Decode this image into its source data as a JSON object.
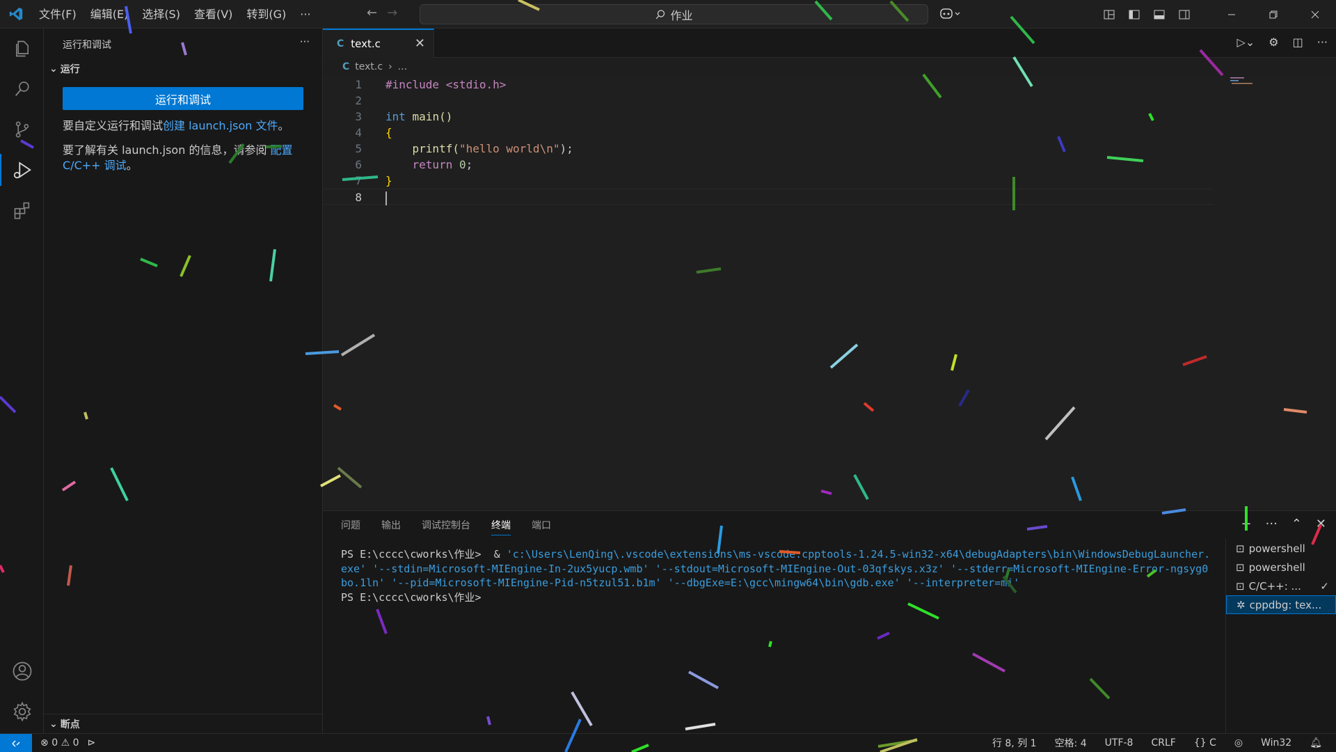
{
  "titlebar": {
    "menus": [
      "文件(F)",
      "编辑(E)",
      "选择(S)",
      "查看(V)",
      "转到(G)",
      "···"
    ],
    "search": "作业"
  },
  "sidebar": {
    "title": "运行和调试",
    "section": "运行",
    "run_button": "运行和调试",
    "text1_a": "要自定义运行和调试",
    "text1_link": "创建 launch.json 文件",
    "text1_b": "。",
    "text2_a": "要了解有关 launch.json 的信息，请参阅 ",
    "text2_link": "配置 C/C++ 调试",
    "text2_b": "。",
    "breakpoints": "断点"
  },
  "editor": {
    "tab_label": "text.c",
    "breadcrumb_file": "text.c",
    "breadcrumb_more": "...",
    "lines": [
      {
        "n": "1"
      },
      {
        "n": "2"
      },
      {
        "n": "3"
      },
      {
        "n": "4"
      },
      {
        "n": "5"
      },
      {
        "n": "6"
      },
      {
        "n": "7"
      },
      {
        "n": "8"
      }
    ],
    "code": {
      "l1": "#include <stdio.h>",
      "l3a": "int",
      "l3b": " main()",
      "l4": "{",
      "l5a": "    printf(",
      "l5b": "\"hello world\\n\"",
      "l5c": ");",
      "l6a": "    return ",
      "l6b": "0",
      "l6c": ";",
      "l7": "}"
    }
  },
  "panel": {
    "tabs": [
      "问题",
      "输出",
      "调试控制台",
      "终端",
      "端口"
    ],
    "active_tab": "终端",
    "terminal_prompt1": "PS E:\\cccc\\cworks\\作业>  & ",
    "terminal_cmd": "'c:\\Users\\LenQing\\.vscode\\extensions\\ms-vscode.cpptools-1.24.5-win32-x64\\debugAdapters\\bin\\WindowsDebugLauncher.exe' '--stdin=Microsoft-MIEngine-In-2ux5yucp.wmb' '--stdout=Microsoft-MIEngine-Out-03qfskys.x3z' '--stderr=Microsoft-MIEngine-Error-ngsyg0bo.1ln' '--pid=Microsoft-MIEngine-Pid-n5tzul51.b1m' '--dbgExe=E:\\gcc\\mingw64\\bin\\gdb.exe' '--interpreter=mi'",
    "terminal_prompt2": "PS E:\\cccc\\cworks\\作业>",
    "terminals": [
      "powershell",
      "powershell",
      "C/C++: ...",
      "cppdbg: tex..."
    ]
  },
  "statusbar": {
    "errors": "0",
    "warnings": "0",
    "position": "行 8, 列 1",
    "spaces": "空格: 4",
    "encoding": "UTF-8",
    "eol": "CRLF",
    "language": "C",
    "platform": "Win32"
  },
  "colors": {
    "accent": "#0078d4",
    "editor_bg": "#1f1f1f",
    "sidebar_bg": "#181818"
  }
}
